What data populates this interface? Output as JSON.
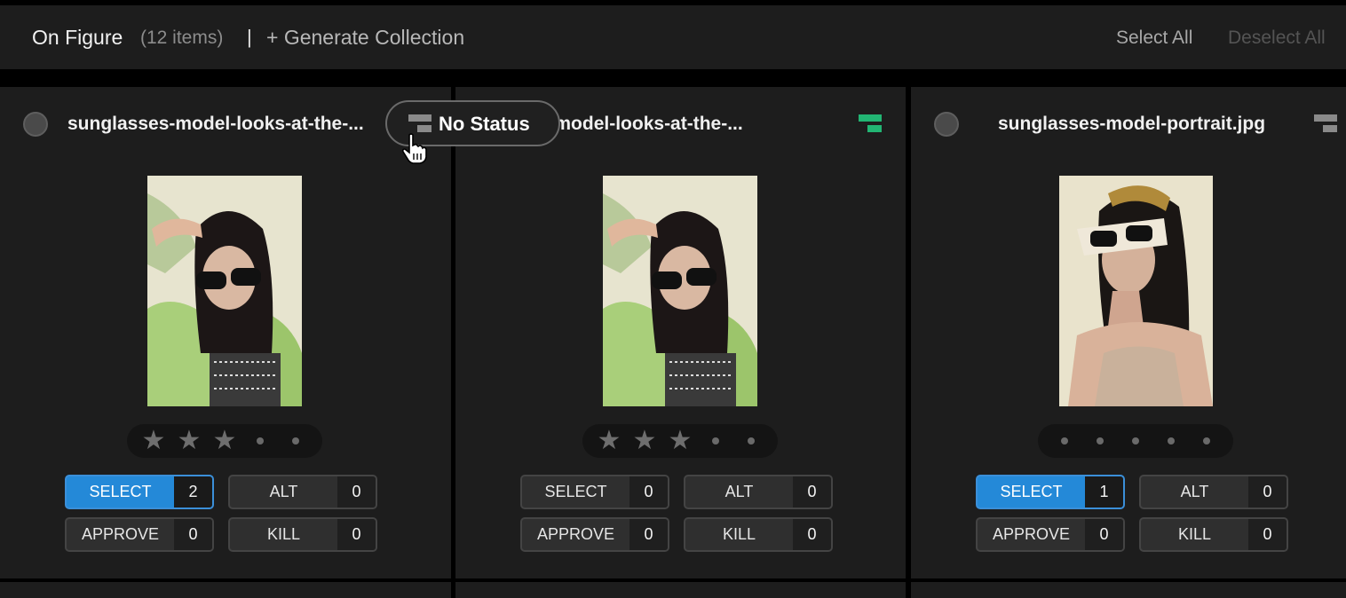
{
  "header": {
    "title": "On Figure",
    "count": "(12 items)",
    "separator": "|",
    "generate_label": "+ Generate Collection",
    "select_all": "Select All",
    "deselect_all": "Deselect All"
  },
  "tooltip": {
    "status_label": "No Status",
    "icon": "status-icon"
  },
  "colors": {
    "accent": "#2489d8",
    "status_green": "#22b573",
    "status_gray": "#8a8a8a"
  },
  "cards": [
    {
      "filename": "sunglasses-model-looks-at-the-...",
      "status": "gray",
      "rating": 3,
      "stars": [
        "★",
        "★",
        "★",
        "•",
        "•"
      ],
      "votes": [
        {
          "label": "SELECT",
          "count": "2",
          "active": true
        },
        {
          "label": "ALT",
          "count": "0",
          "active": false
        },
        {
          "label": "APPROVE",
          "count": "0",
          "active": false
        },
        {
          "label": "KILL",
          "count": "0",
          "active": false
        }
      ]
    },
    {
      "filename": "sunglasses-model-looks-at-the-...",
      "status": "green",
      "rating": 3,
      "stars": [
        "★",
        "★",
        "★",
        "•",
        "•"
      ],
      "votes": [
        {
          "label": "SELECT",
          "count": "0",
          "active": false
        },
        {
          "label": "ALT",
          "count": "0",
          "active": false
        },
        {
          "label": "APPROVE",
          "count": "0",
          "active": false
        },
        {
          "label": "KILL",
          "count": "0",
          "active": false
        }
      ]
    },
    {
      "filename": "sunglasses-model-portrait.jpg",
      "status": "gray",
      "rating": 0,
      "stars": [
        "•",
        "•",
        "•",
        "•",
        "•"
      ],
      "votes": [
        {
          "label": "SELECT",
          "count": "1",
          "active": true
        },
        {
          "label": "ALT",
          "count": "0",
          "active": false
        },
        {
          "label": "APPROVE",
          "count": "0",
          "active": false
        },
        {
          "label": "KILL",
          "count": "0",
          "active": false
        }
      ]
    }
  ]
}
